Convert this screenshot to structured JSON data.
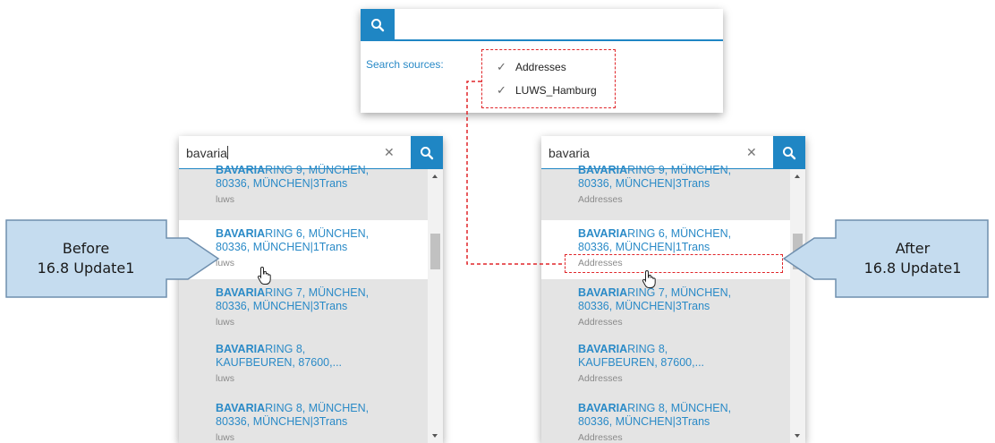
{
  "sources_card": {
    "label": "Search sources:",
    "sources": [
      {
        "name": "Addresses",
        "checked": true
      },
      {
        "name": "LUWS_Hamburg",
        "checked": true
      }
    ]
  },
  "left_panel": {
    "query": "bavaria",
    "results": [
      {
        "bold": "BAVARIA",
        "rest": "RING 9, MÜNCHEN,",
        "l2": "80336, MÜNCHEN|3Trans",
        "source": "luws"
      },
      {
        "bold": "BAVARIA",
        "rest": "RING 6, MÜNCHEN,",
        "l2": "80336, MÜNCHEN|1Trans",
        "source": "luws"
      },
      {
        "bold": "BAVARIA",
        "rest": "RING 7, MÜNCHEN,",
        "l2": "80336, MÜNCHEN|3Trans",
        "source": "luws"
      },
      {
        "bold": "BAVARIA",
        "rest": "RING 8,",
        "l2": "KAUFBEUREN, 87600,...",
        "source": "luws"
      },
      {
        "bold": "BAVARIA",
        "rest": "RING 8, MÜNCHEN,",
        "l2": "80336, MÜNCHEN|3Trans",
        "source": "luws"
      }
    ]
  },
  "right_panel": {
    "query": "bavaria",
    "results": [
      {
        "bold": "BAVARIA",
        "rest": "RING 9, MÜNCHEN,",
        "l2": "80336, MÜNCHEN|3Trans",
        "source": "Addresses"
      },
      {
        "bold": "BAVARIA",
        "rest": "RING 6, MÜNCHEN,",
        "l2": "80336, MÜNCHEN|1Trans",
        "source": "Addresses"
      },
      {
        "bold": "BAVARIA",
        "rest": "RING 7, MÜNCHEN,",
        "l2": "80336, MÜNCHEN|3Trans",
        "source": "Addresses"
      },
      {
        "bold": "BAVARIA",
        "rest": "RING 8,",
        "l2": "KAUFBEUREN, 87600,...",
        "source": "Addresses"
      },
      {
        "bold": "BAVARIA",
        "rest": "RING 8, MÜNCHEN,",
        "l2": "80336, MÜNCHEN|3Trans",
        "source": "Addresses"
      }
    ]
  },
  "callouts": {
    "before": {
      "line1": "Before",
      "line2": "16.8 Update1"
    },
    "after": {
      "line1": "After",
      "line2": "16.8 Update1"
    }
  },
  "icons": {
    "search": "search-icon",
    "clear": "close-icon",
    "check": "checkmark-icon",
    "cursor": "hand-pointer-icon"
  },
  "colors": {
    "accent": "#1f86c4",
    "link": "#2a8ac7",
    "highlight_dash": "#e0262a",
    "callout_fill": "#c5dcef",
    "callout_stroke": "#6f8fae"
  }
}
